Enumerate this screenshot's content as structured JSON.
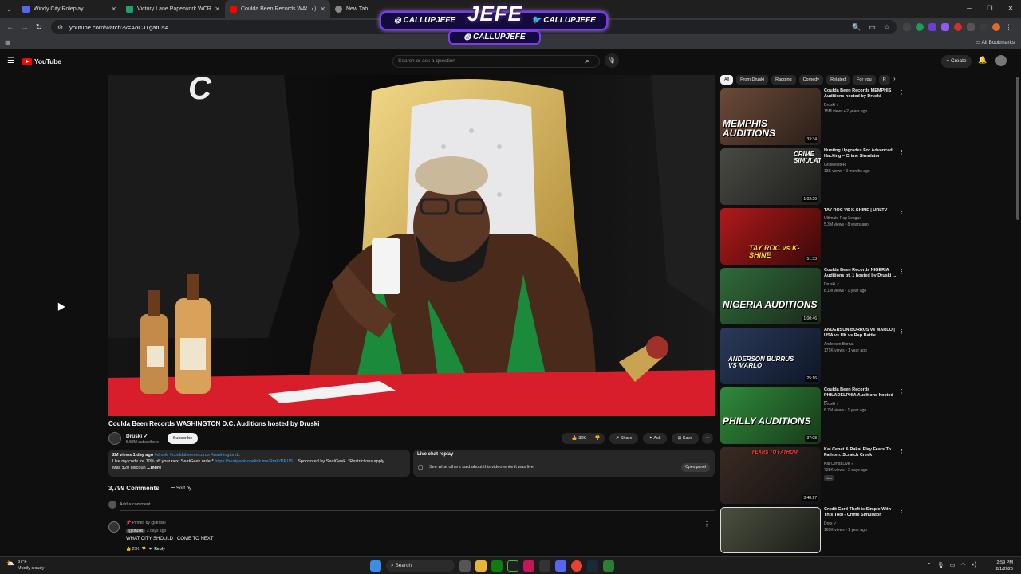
{
  "browser": {
    "tabs": [
      {
        "title": "Windy City Roleplay",
        "color": "#5865f2"
      },
      {
        "title": "Victory Lane Paperwork WCRP",
        "color": "#1ea362"
      },
      {
        "title": "Coulda Been Records WAS",
        "color": "#ff0000"
      },
      {
        "title": "New Tab",
        "color": "#aaaaaa"
      }
    ],
    "url": "youtube.com/watch?v=AoCJTgatCsA",
    "bookmarks_label": "All Bookmarks"
  },
  "overlay": {
    "left_handle": "CALLUPJEFE",
    "right_handle": "CALLUPJEFE",
    "bottom_handle": "CALLUPJEFE",
    "logo": "JEFE"
  },
  "youtube": {
    "logo_text": "YouTube",
    "search_placeholder": "Search or ask a question",
    "create_label": "Create"
  },
  "video": {
    "title": "Coulda Been Records WASHINGTON D.C. Auditions hosted by Druski",
    "channel": "Druski",
    "subscribers": "5.88M subscribers",
    "subscribe_label": "Subscribe",
    "likes": "30K",
    "share_label": "Share",
    "ask_label": "Ask",
    "save_label": "Save",
    "views_date": "2M views  1 day ago",
    "hashtags": "#druski #couldabeenrecords #washingtondc",
    "desc_line2_a": "Use my code for 10% off your next SeatGeek order* ",
    "desc_link": "https://seatgeek.onelink.me/RmK/DRUS...",
    "desc_line2_b": " Sponsored by SeatGeek. *Restrictions apply.",
    "desc_line3": "Max $20 discoun",
    "desc_more": "...more",
    "livechat_title": "Live chat replay",
    "livechat_sub": "See what others said about this video while it was live.",
    "open_panel": "Open panel"
  },
  "comments": {
    "count": "3,799 Comments",
    "sort": "Sort by",
    "add_placeholder": "Add a comment...",
    "pinned": "Pinned by @druski",
    "author": "@druski",
    "age": "2 days ago",
    "text": "WHAT CITY SHOULD I COME TO NEXT",
    "likes": "25K",
    "reply": "Reply"
  },
  "chips": [
    "All",
    "From Druski",
    "Rapping",
    "Comedy",
    "Related",
    "For you",
    "R"
  ],
  "recommendations": [
    {
      "title": "Coulda Been Records MEMPHIS Auditions hosted by Druski",
      "channel": "Druski",
      "meta": "15M views • 2 years ago",
      "duration": "33:34",
      "thumb_text": "MEMPHIS AUDITIONS"
    },
    {
      "title": "Hunting Upgrades For Advanced Hacking – Crime Simulator",
      "channel": "GrillMeisteR",
      "meta": "13K views • 9 months ago",
      "duration": "1:02:29",
      "thumb_text": "CRIME SIMULATOR"
    },
    {
      "title": "TAY ROC VS K-SHINE | URLTV",
      "channel": "Ultimate Rap League",
      "meta": "5.3M views • 8 years ago",
      "duration": "51:33",
      "thumb_text": "TAY ROC vs K-SHINE"
    },
    {
      "title": "Coulda Been Records NIGERIA Auditions pt. 1 hosted by Druski ...",
      "channel": "Druski",
      "meta": "8.1M views • 1 year ago",
      "duration": "1:00:46",
      "thumb_text": "NIGERIA AUDITIONS"
    },
    {
      "title": "ANDERSON BURRUS vs MARLO | USA vs UK vs Rap Battle",
      "channel": "Anderson Burrus",
      "meta": "171K views • 1 year ago",
      "duration": "25:16",
      "thumb_text": "ANDERSON BURRUS VS MARLO"
    },
    {
      "title": "Coulda Been Records PHILADELPHIA Auditions hosted ...",
      "channel": "Druski",
      "meta": "8.7M views • 1 year ago",
      "duration": "37:08",
      "thumb_text": "PHILLY AUDITIONS"
    },
    {
      "title": "Kai Cenat & Rakai Play Fears To Fathom: Scratch Creek",
      "channel": "Kai Cenat Live",
      "meta": "728K views • 2 days ago",
      "badge": "New",
      "duration": "3:48:27",
      "thumb_text": "FEARS TO FATHOM"
    },
    {
      "title": "Credit Card Theft is Simple With This Tool - Crime Simulator",
      "channel": "Drex",
      "meta": "169K views • 1 year ago",
      "duration": "",
      "thumb_text": ""
    }
  ],
  "taskbar": {
    "temp": "87°F",
    "condition": "Mostly cloudy",
    "search": "Search",
    "time": "2:59 PM",
    "date": "8/1/2026"
  }
}
